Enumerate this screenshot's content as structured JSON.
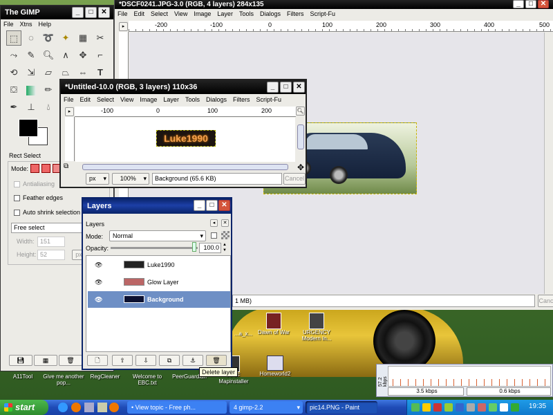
{
  "desktop": {
    "icons": [
      {
        "label": "A11Tool"
      },
      {
        "label": "Give me another pop..."
      },
      {
        "label": "RegCleaner"
      },
      {
        "label": "Welcome to EBC.txt"
      },
      {
        "label": "PeerGuardian"
      },
      {
        "label": "FFTF Mapinstaller"
      },
      {
        "label": "Homeworld2"
      },
      {
        "label": "Dawn of War"
      },
      {
        "label": "URGENCY Modern In..."
      },
      {
        "label": "...a_x..."
      }
    ]
  },
  "toolbox": {
    "title": "The GIMP",
    "menu": [
      "File",
      "Xtns",
      "Help"
    ],
    "tool_options_title": "Rect Select",
    "mode_label": "Mode:",
    "antialiasing": "Antialiasing",
    "feather_edges": "Feather edges",
    "auto_shrink": "Auto shrink selection",
    "select_mode": "Free select",
    "width_label": "Width:",
    "width_value": "151",
    "height_label": "Height:",
    "height_value": "52",
    "px": "px"
  },
  "main_window": {
    "title": "*DSCF0241.JPG-3.0 (RGB, 4 layers) 284x135",
    "menu": [
      "File",
      "Edit",
      "Select",
      "View",
      "Image",
      "Layer",
      "Tools",
      "Dialogs",
      "Filters",
      "Script-Fu"
    ],
    "ruler_labels": [
      "-200",
      "-100",
      "0",
      "100",
      "200",
      "300",
      "400",
      "500"
    ],
    "status_text": "1 MB)",
    "cancel": "Canc"
  },
  "untitled_window": {
    "title": "*Untitled-10.0 (RGB, 3 layers) 110x36",
    "menu": [
      "File",
      "Edit",
      "Select",
      "View",
      "Image",
      "Layer",
      "Tools",
      "Dialogs",
      "Filters",
      "Script-Fu"
    ],
    "ruler_labels": [
      "-100",
      "0",
      "100",
      "200"
    ],
    "canvas_text": "Luke1990",
    "unit": "px",
    "zoom": "100%",
    "status": "Background (65.6 KB)",
    "cancel": "Cancel"
  },
  "layers_dialog": {
    "title": "Layers",
    "section": "Layers",
    "mode_label": "Mode:",
    "mode_value": "Normal",
    "opacity_label": "Opacity:",
    "opacity_value": "100.0",
    "layers": [
      {
        "name": "Luke1990"
      },
      {
        "name": "Glow Layer"
      },
      {
        "name": "Background"
      }
    ],
    "tooltip": "Delete layer"
  },
  "network_monitor": {
    "y_label": "57.2 kbps",
    "down": "3.5 kbps",
    "up": "0.6 kbps"
  },
  "taskbar": {
    "start": "start",
    "tasks": [
      {
        "label": "• View topic - Free ph..."
      },
      {
        "label": "4 gimp-2.2"
      },
      {
        "label": "pic14.PNG - Paint"
      }
    ],
    "clock": "19:35"
  },
  "colors": {
    "accent": "#0a246a",
    "selected_layer": "#6e8fc5",
    "taskbar": "#1f4bb6",
    "start": "#3a9a3a"
  }
}
